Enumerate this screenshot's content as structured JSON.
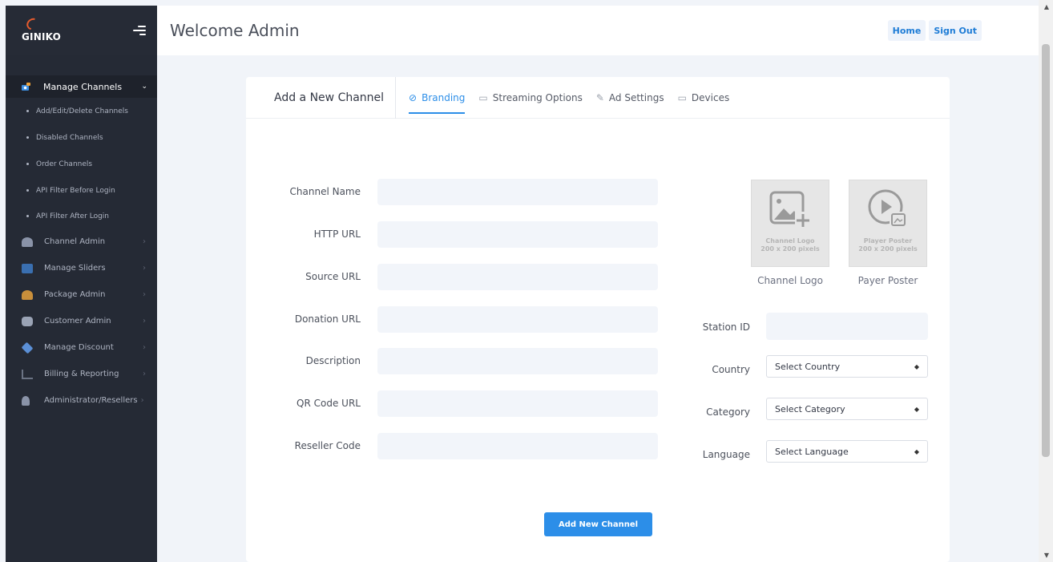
{
  "brand": {
    "name": "GINIKO"
  },
  "topbar": {
    "title": "Welcome Admin",
    "home_label": "Home",
    "signout_label": "Sign Out"
  },
  "sidebar": {
    "active_section": "Manage Channels",
    "sub_items": [
      "Add/Edit/Delete Channels",
      "Disabled Channels",
      "Order Channels",
      "API Filter Before Login",
      "API Filter After Login"
    ],
    "items": [
      {
        "label": "Channel Admin",
        "icon": "users-icon",
        "color": "#8a93a8"
      },
      {
        "label": "Manage Sliders",
        "icon": "slider-icon",
        "color": "#3a6fb0"
      },
      {
        "label": "Package Admin",
        "icon": "package-icon",
        "color": "#c98f3b"
      },
      {
        "label": "Customer Admin",
        "icon": "customers-icon",
        "color": "#9aa3b5"
      },
      {
        "label": "Manage Discount",
        "icon": "discount-icon",
        "color": "#5b8fd6"
      },
      {
        "label": "Billing & Reporting",
        "icon": "chart-icon",
        "color": "#6b7384"
      },
      {
        "label": "Administrator/Resellers",
        "icon": "admin-icon",
        "color": "#8a93a8"
      }
    ]
  },
  "card": {
    "title": "Add a New Channel",
    "tabs": [
      {
        "label": "Branding",
        "icon": "tag-icon",
        "active": true
      },
      {
        "label": "Streaming Options",
        "icon": "cast-icon",
        "active": false
      },
      {
        "label": "Ad Settings",
        "icon": "megaphone-icon",
        "active": false
      },
      {
        "label": "Devices",
        "icon": "devices-icon",
        "active": false
      }
    ]
  },
  "form": {
    "left_fields": [
      {
        "label": "Channel Name",
        "value": ""
      },
      {
        "label": "HTTP URL",
        "value": ""
      },
      {
        "label": "Source URL",
        "value": ""
      },
      {
        "label": "Donation URL",
        "value": ""
      },
      {
        "label": "Description",
        "value": ""
      },
      {
        "label": "QR Code URL",
        "value": ""
      },
      {
        "label": "Reseller Code",
        "value": ""
      }
    ],
    "station_id_label": "Station ID",
    "country_label": "Country",
    "country_selected": "Select Country",
    "category_label": "Category",
    "category_selected": "Select Category",
    "language_label": "Language",
    "language_selected": "Select Language",
    "channel_logo": {
      "caption_line1": "Channel Logo",
      "caption_line2": "200 x 200 pixels",
      "label": "Channel Logo"
    },
    "player_poster": {
      "caption_line1": "Player Poster",
      "caption_line2": "200 x 200 pixels",
      "label": "Payer Poster"
    },
    "submit_label": "Add New Channel"
  },
  "colors": {
    "accent": "#2c8ee8",
    "sidebar_bg": "#252a35",
    "brand_orange": "#e75b2d"
  }
}
